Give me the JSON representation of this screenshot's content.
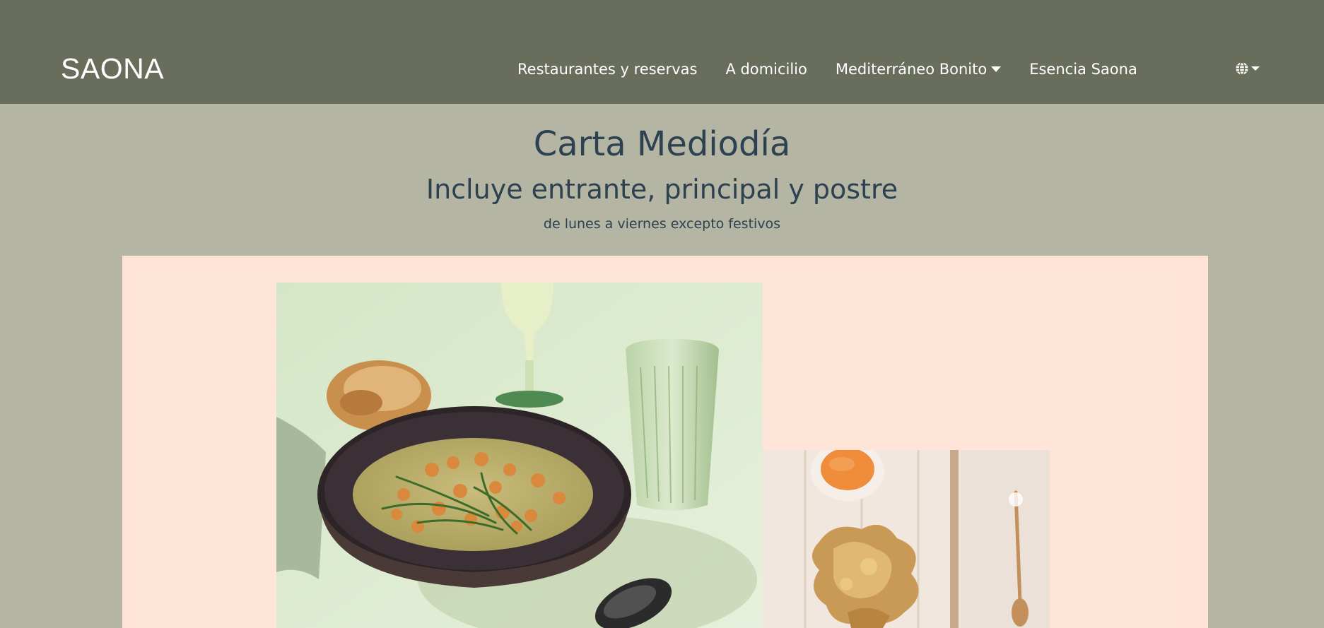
{
  "header": {
    "brand": "SAONA",
    "nav": [
      {
        "label": "Restaurantes y reservas"
      },
      {
        "label": "A domicilio"
      },
      {
        "label": "Mediterráneo Bonito",
        "dropdown": true
      },
      {
        "label": "Esencia Saona"
      }
    ],
    "language_icon": "globe-icon"
  },
  "hero": {
    "title": "Carta Mediodía",
    "subtitle": "Incluye entrante, principal y postre",
    "note": "de lunes a viernes excepto festivos"
  },
  "images": {
    "soup": "bowl of creamy soup with chickpeas and samphire, bread, glass of water and wine",
    "fried": "fried vegetables with a small bowl of orange dip and a fork"
  },
  "colors": {
    "navbar": "#686e5b",
    "background": "#b5b5a4",
    "panel": "#ffe4d6",
    "heading": "#2d4150"
  }
}
